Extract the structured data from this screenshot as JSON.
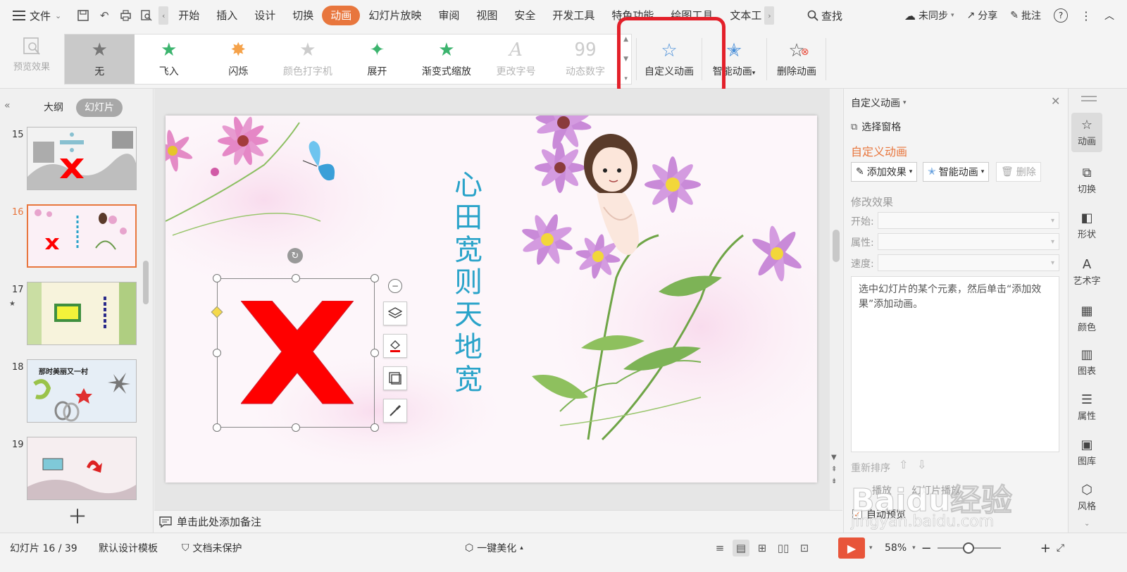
{
  "menubar": {
    "file_label": "文件",
    "tabs": [
      "开始",
      "插入",
      "设计",
      "切换",
      "动画",
      "幻灯片放映",
      "审阅",
      "视图",
      "安全",
      "开发工具",
      "特色功能",
      "绘图工具",
      "文本工"
    ],
    "search_label": "查找",
    "sync_label": "未同步",
    "share_label": "分享",
    "review_label": "批注"
  },
  "ribbon": {
    "preview_label": "预览效果",
    "effects": [
      {
        "label": "无",
        "icon": "star-icon"
      },
      {
        "label": "飞入",
        "icon": "fly-in-icon"
      },
      {
        "label": "闪烁",
        "icon": "flash-icon"
      },
      {
        "label": "颜色打字机",
        "icon": "typewriter-icon"
      },
      {
        "label": "展开",
        "icon": "expand-icon"
      },
      {
        "label": "渐变式缩放",
        "icon": "zoom-icon"
      },
      {
        "label": "更改字号",
        "icon": "font-size-icon"
      },
      {
        "label": "动态数字",
        "icon": "dynamic-number-icon"
      }
    ],
    "custom_animation_label": "自定义动画",
    "smart_animation_label": "智能动画",
    "delete_animation_label": "删除动画"
  },
  "left_panel": {
    "tab_outline": "大纲",
    "tab_slides": "幻灯片",
    "slides": [
      {
        "num": "15",
        "star": ""
      },
      {
        "num": "16",
        "star": ""
      },
      {
        "num": "17",
        "star": "★"
      },
      {
        "num": "18",
        "star": ""
      },
      {
        "num": "19",
        "star": ""
      }
    ],
    "thumb18_title": "那时美丽又一村"
  },
  "slide": {
    "vertical_title": [
      "心",
      "田",
      "宽",
      "则",
      "天",
      "地",
      "宽"
    ]
  },
  "notes": {
    "placeholder": "单击此处添加备注"
  },
  "task_pane": {
    "title": "自定义动画",
    "select_pane": "选择窗格",
    "section_title": "自定义动画",
    "add_effect": "添加效果",
    "smart_animation": "智能动画",
    "delete": "删除",
    "modify_title": "修改效果",
    "start_label": "开始:",
    "property_label": "属性:",
    "speed_label": "速度:",
    "hint": "选中幻灯片的某个元素，然后单击“添加效果”添加动画。",
    "reorder_label": "重新排序",
    "play_label": "播放",
    "slideshow_label": "幻灯片播放",
    "auto_preview": "自动预览"
  },
  "sidebar": {
    "items": [
      {
        "label": "动画",
        "icon": "animation-icon"
      },
      {
        "label": "切换",
        "icon": "transition-icon"
      },
      {
        "label": "形状",
        "icon": "shape-icon"
      },
      {
        "label": "艺术字",
        "icon": "wordart-icon"
      },
      {
        "label": "颜色",
        "icon": "color-icon"
      },
      {
        "label": "图表",
        "icon": "chart-icon"
      },
      {
        "label": "属性",
        "icon": "property-icon"
      },
      {
        "label": "图库",
        "icon": "gallery-icon"
      },
      {
        "label": "风格",
        "icon": "style-icon"
      }
    ]
  },
  "statusbar": {
    "slide_info": "幻灯片 16 / 39",
    "template": "默认设计模板",
    "protection": "文档未保护",
    "beautify": "一键美化",
    "zoom": "58%"
  },
  "watermark": {
    "brand": "Baidu经验",
    "url": "jingyan.baidu.com"
  },
  "colors": {
    "accent": "#e8763d",
    "highlight_box": "#e3202a",
    "red_x": "#ff0000",
    "title_blue": "#2aa3c9"
  }
}
